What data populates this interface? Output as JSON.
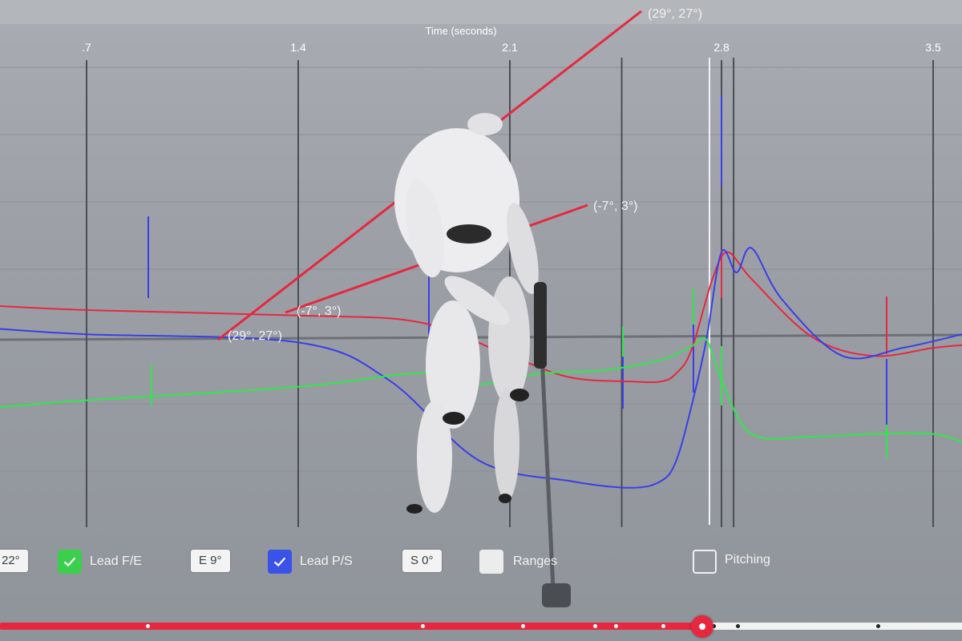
{
  "chart_data": {
    "type": "line",
    "xlabel": "Time (seconds)",
    "x_ticks": [
      ".7",
      "1.4",
      "2.1",
      "2.8",
      "3.5"
    ],
    "series": [
      {
        "color": "#e5283f",
        "x": [
          0.0,
          0.7,
          1.4,
          1.8,
          2.1,
          2.3,
          2.5,
          2.6,
          2.65,
          2.7,
          2.77,
          2.82,
          2.9,
          3.1,
          3.3,
          3.5,
          3.6
        ],
        "y": [
          2.5,
          2.2,
          1.8,
          1.3,
          -1.2,
          -2.8,
          -3.1,
          -3.1,
          -2.5,
          -0.8,
          4.5,
          6.5,
          4.5,
          0.2,
          -1.2,
          -0.6,
          -0.4
        ]
      },
      {
        "color": "#3a3ee8",
        "x": [
          0.0,
          0.7,
          1.4,
          1.7,
          2.0,
          2.3,
          2.5,
          2.6,
          2.65,
          2.7,
          2.75,
          2.8,
          2.85,
          2.9,
          3.0,
          3.2,
          3.4,
          3.6
        ],
        "y": [
          0.8,
          0.4,
          -0.2,
          -3.0,
          -9.0,
          -10.5,
          -11.0,
          -10.5,
          -9.0,
          -5.0,
          0.0,
          6.5,
          5.0,
          6.8,
          3.0,
          -1.2,
          -0.6,
          0.4
        ]
      },
      {
        "color": "#2ee84a",
        "x": [
          0.0,
          0.7,
          1.4,
          1.8,
          2.0,
          2.2,
          2.4,
          2.6,
          2.7,
          2.75,
          2.8,
          2.9,
          3.1,
          3.3,
          3.5,
          3.6
        ],
        "y": [
          -5.0,
          -4.5,
          -3.5,
          -2.5,
          -3.3,
          -2.5,
          -2.3,
          -1.5,
          -0.5,
          0.0,
          -3.0,
          -7.0,
          -7.2,
          -7.0,
          -7.0,
          -7.6
        ]
      }
    ],
    "annotations": [
      "(29°, 27°)",
      "(-7°, 3°)",
      "(-7°, 3°)",
      "(29°, 27°)"
    ],
    "grid": true
  },
  "controls": {
    "box1": "22°",
    "lead_fe_label": "Lead F/E",
    "box2": "E 9°",
    "lead_ps_label": "Lead P/S",
    "box3": "S 0°",
    "ranges_label": "Ranges",
    "pitching_label": "Pitching"
  },
  "colors": {
    "red": "#e5283f",
    "blue": "#3a3ee8",
    "green": "#2ee84a",
    "check_green": "#3ccf4e",
    "check_blue": "#3a52e8"
  },
  "icons": [
    "check-icon",
    "golf-figure-icon"
  ],
  "timeline": {
    "progress": 0.73
  }
}
